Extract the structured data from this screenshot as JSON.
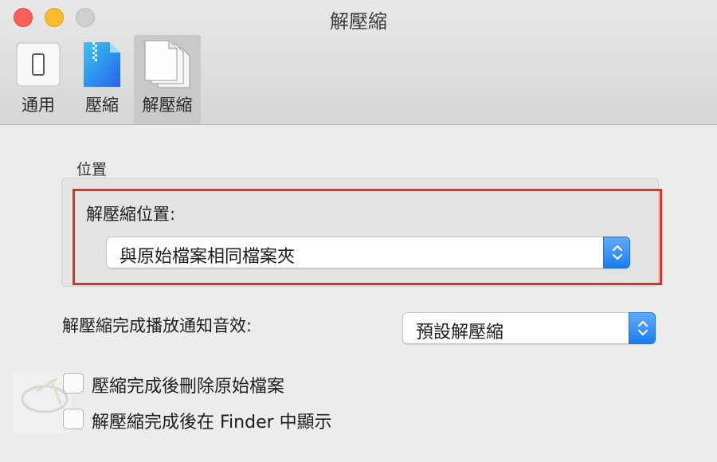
{
  "window": {
    "title": "解壓縮"
  },
  "toolbar": {
    "tabs": [
      {
        "label": "通用",
        "icon": "switch-icon",
        "active": false
      },
      {
        "label": "壓縮",
        "icon": "zip-file-icon",
        "active": false
      },
      {
        "label": "解壓縮",
        "icon": "documents-icon",
        "active": true
      }
    ]
  },
  "location": {
    "section_title": "位置",
    "label": "解壓縮位置:",
    "selected": "與原始檔案相同檔案夾"
  },
  "sound": {
    "label": "解壓縮完成播放通知音效:",
    "selected": "預設解壓縮"
  },
  "options": [
    {
      "label": "壓縮完成後刪除原始檔案",
      "checked": false
    },
    {
      "label": "解壓縮完成後在 Finder 中顯示",
      "checked": false
    }
  ],
  "colors": {
    "highlight_border": "#e2321e",
    "stepper_blue": "#1a7df0",
    "close": "#fc5f57",
    "minimize": "#fdbc2e",
    "zoom_inactive": "#cfcfcf"
  }
}
